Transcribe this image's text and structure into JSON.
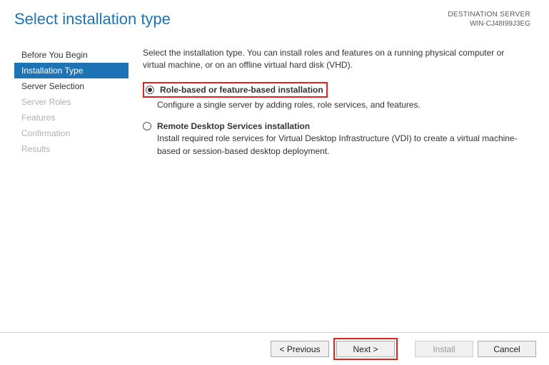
{
  "header": {
    "title": "Select installation type",
    "destination_label": "DESTINATION SERVER",
    "destination_name": "WIN-CJ48I99J3EG"
  },
  "sidebar": {
    "items": [
      {
        "label": "Before You Begin",
        "state": "normal"
      },
      {
        "label": "Installation Type",
        "state": "active"
      },
      {
        "label": "Server Selection",
        "state": "normal"
      },
      {
        "label": "Server Roles",
        "state": "disabled"
      },
      {
        "label": "Features",
        "state": "disabled"
      },
      {
        "label": "Confirmation",
        "state": "disabled"
      },
      {
        "label": "Results",
        "state": "disabled"
      }
    ]
  },
  "content": {
    "intro": "Select the installation type. You can install roles and features on a running physical computer or virtual machine, or on an offline virtual hard disk (VHD).",
    "options": [
      {
        "title": "Role-based or feature-based installation",
        "desc": "Configure a single server by adding roles, role services, and features.",
        "checked": true,
        "highlighted": true
      },
      {
        "title": "Remote Desktop Services installation",
        "desc": "Install required role services for Virtual Desktop Infrastructure (VDI) to create a virtual machine-based or session-based desktop deployment.",
        "checked": false,
        "highlighted": false
      }
    ]
  },
  "footer": {
    "previous": "< Previous",
    "next": "Next >",
    "install": "Install",
    "cancel": "Cancel"
  }
}
